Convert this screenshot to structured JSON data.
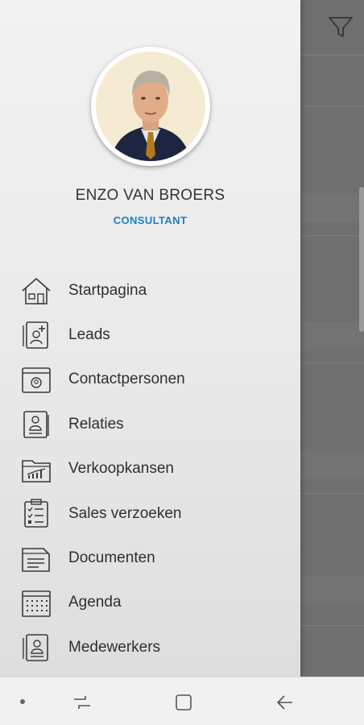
{
  "profile": {
    "name": "ENZO VAN BROERS",
    "role": "CONSULTANT",
    "photo": "portrait-photo"
  },
  "menu": [
    {
      "label": "Startpagina",
      "icon": "home-icon"
    },
    {
      "label": "Leads",
      "icon": "lead-add-icon"
    },
    {
      "label": "Contactpersonen",
      "icon": "contact-card-icon"
    },
    {
      "label": "Relaties",
      "icon": "relation-stamp-icon"
    },
    {
      "label": "Verkoopkansen",
      "icon": "sales-chart-folder-icon"
    },
    {
      "label": "Sales verzoeken",
      "icon": "checklist-clipboard-icon"
    },
    {
      "label": "Documenten",
      "icon": "documents-icon"
    },
    {
      "label": "Agenda",
      "icon": "calendar-icon"
    },
    {
      "label": "Medewerkers",
      "icon": "employees-icon"
    }
  ],
  "background": {
    "filter_icon": "filter-icon"
  },
  "navbar": {
    "dot": "nav-dot-icon",
    "recents": "recents-icon",
    "home": "home-button-icon",
    "back": "back-arrow-icon"
  },
  "colors": {
    "accent": "#1f7fc1",
    "overlay": "#6f6f6f"
  }
}
